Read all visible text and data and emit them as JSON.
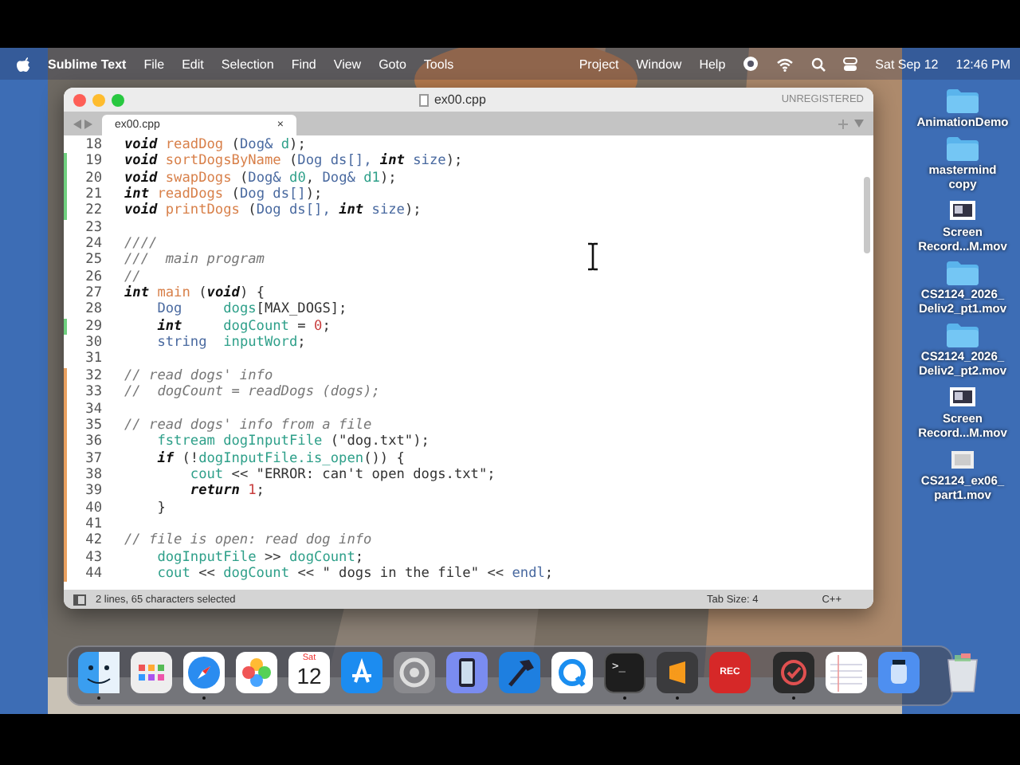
{
  "menu_bar": {
    "app": "Sublime Text",
    "items": [
      "File",
      "Edit",
      "Selection",
      "Find",
      "View",
      "Goto",
      "Tools"
    ],
    "right_items": [
      "Project",
      "Window",
      "Help"
    ],
    "date": "Sat Sep 12",
    "time": "12:46 PM"
  },
  "window": {
    "title": "ex00.cpp",
    "badge": "UNREGISTERED",
    "tabs": [
      {
        "label": "ex00.cpp",
        "selected": true,
        "close": "×"
      }
    ],
    "lines": [
      {
        "number": "18",
        "tokens": [
          {
            "kind": "kw",
            "text": "void "
          },
          {
            "kind": "fn",
            "text": "readDog "
          },
          {
            "kind": "p",
            "text": "("
          },
          {
            "kind": "type",
            "text": "Dog& "
          },
          {
            "kind": "var",
            "text": "d"
          },
          {
            "kind": "p",
            "text": ");"
          }
        ]
      },
      {
        "number": "19",
        "color": "#6fcf7f",
        "tokens": [
          {
            "kind": "kw",
            "text": "void "
          },
          {
            "kind": "fn",
            "text": "sortDogsByName "
          },
          {
            "kind": "p",
            "text": "("
          },
          {
            "kind": "type",
            "text": "Dog ds[], "
          },
          {
            "kind": "kw",
            "text": "int "
          },
          {
            "kind": "type",
            "text": "size"
          },
          {
            "kind": "p",
            "text": ");"
          }
        ]
      },
      {
        "number": "20",
        "color": "#6fcf7f",
        "tokens": [
          {
            "kind": "kw",
            "text": "void "
          },
          {
            "kind": "fn",
            "text": "swapDogs "
          },
          {
            "kind": "p",
            "text": "("
          },
          {
            "kind": "type",
            "text": "Dog& "
          },
          {
            "kind": "var",
            "text": "d0"
          },
          {
            "kind": "p",
            "text": ", "
          },
          {
            "kind": "type",
            "text": "Dog& "
          },
          {
            "kind": "var",
            "text": "d1"
          },
          {
            "kind": "p",
            "text": ");"
          }
        ]
      },
      {
        "number": "21",
        "color": "#6fcf7f",
        "tokens": [
          {
            "kind": "kw",
            "text": "int "
          },
          {
            "kind": "fn",
            "text": "readDogs "
          },
          {
            "kind": "p",
            "text": "("
          },
          {
            "kind": "type",
            "text": "Dog ds[]"
          },
          {
            "kind": "p",
            "text": ");"
          }
        ]
      },
      {
        "number": "22",
        "color": "#6fcf7f",
        "tokens": [
          {
            "kind": "kw",
            "text": "void "
          },
          {
            "kind": "fn",
            "text": "printDogs "
          },
          {
            "kind": "p",
            "text": "("
          },
          {
            "kind": "type",
            "text": "Dog ds[], "
          },
          {
            "kind": "kw",
            "text": "int "
          },
          {
            "kind": "type",
            "text": "size"
          },
          {
            "kind": "p",
            "text": ");"
          }
        ]
      },
      {
        "number": "23"
      },
      {
        "number": "24",
        "tokens": [
          {
            "kind": "cmt",
            "text": "////"
          }
        ]
      },
      {
        "number": "25",
        "tokens": [
          {
            "kind": "cmt",
            "text": "///  main program"
          }
        ]
      },
      {
        "number": "26",
        "tokens": [
          {
            "kind": "cmt",
            "text": "//"
          }
        ]
      },
      {
        "number": "27",
        "tokens": [
          {
            "kind": "kw",
            "text": "int "
          },
          {
            "kind": "fn",
            "text": "main "
          },
          {
            "kind": "p",
            "text": "("
          },
          {
            "kind": "kw",
            "text": "void"
          },
          {
            "kind": "p",
            "text": ") {"
          }
        ]
      },
      {
        "number": "28",
        "tokens": [
          {
            "kind": "type",
            "text": "    Dog     "
          },
          {
            "kind": "var",
            "text": "dogs"
          },
          {
            "kind": "p",
            "text": "[MAX_DOGS];"
          }
        ]
      },
      {
        "number": "29",
        "color": "#6fcf7f",
        "tokens": [
          {
            "kind": "kw",
            "text": "    int     "
          },
          {
            "kind": "var",
            "text": "dogCount"
          },
          {
            "kind": "p",
            "text": " = "
          },
          {
            "kind": "num",
            "text": "0"
          },
          {
            "kind": "p",
            "text": ";"
          }
        ]
      },
      {
        "number": "30",
        "tokens": [
          {
            "kind": "type",
            "text": "    string  "
          },
          {
            "kind": "var",
            "text": "inputWord"
          },
          {
            "kind": "p",
            "text": ";"
          }
        ]
      },
      {
        "number": "31"
      },
      {
        "number": "32",
        "color": "#e8a060",
        "tokens": [
          {
            "kind": "cmt",
            "text": "// read dogs' info"
          }
        ]
      },
      {
        "number": "33",
        "color": "#e8a060",
        "tokens": [
          {
            "kind": "cmt",
            "text": "//  dogCount = readDogs (dogs);"
          }
        ]
      },
      {
        "number": "34",
        "color": "#e8a060"
      },
      {
        "number": "35",
        "color": "#e8a060",
        "tokens": [
          {
            "kind": "cmt",
            "text": "// read dogs' info from a file"
          }
        ]
      },
      {
        "number": "36",
        "color": "#e8a060",
        "tokens": [
          {
            "kind": "var",
            "text": "    fstream dogInputFile"
          },
          {
            "kind": "p",
            "text": " (\"dog.txt\");"
          }
        ]
      },
      {
        "number": "37",
        "color": "#e8a060",
        "tokens": [
          {
            "kind": "kw",
            "text": "    if"
          },
          {
            "kind": "p",
            "text": " (!"
          },
          {
            "kind": "var",
            "text": "dogInputFile.is_open"
          },
          {
            "kind": "p",
            "text": "()) {"
          }
        ]
      },
      {
        "number": "38",
        "color": "#e8a060",
        "tokens": [
          {
            "kind": "var",
            "text": "        cout"
          },
          {
            "kind": "p",
            "text": " << \"ERROR: can't open dogs.txt\";"
          }
        ]
      },
      {
        "number": "39",
        "color": "#e8a060",
        "tokens": [
          {
            "kind": "kw",
            "text": "        return "
          },
          {
            "kind": "num",
            "text": "1"
          },
          {
            "kind": "p",
            "text": ";"
          }
        ]
      },
      {
        "number": "40",
        "color": "#e8a060",
        "tokens": [
          {
            "kind": "p",
            "text": "    }"
          }
        ]
      },
      {
        "number": "41",
        "color": "#e8a060"
      },
      {
        "number": "42",
        "color": "#e8a060",
        "tokens": [
          {
            "kind": "cmt",
            "text": "// file is open: read dog info"
          }
        ]
      },
      {
        "number": "43",
        "color": "#e8a060",
        "tokens": [
          {
            "kind": "var",
            "text": "    dogInputFile"
          },
          {
            "kind": "p",
            "text": " >> "
          },
          {
            "kind": "var",
            "text": "dogCount"
          },
          {
            "kind": "p",
            "text": ";"
          }
        ]
      },
      {
        "number": "44",
        "color": "#e8a060",
        "tokens": [
          {
            "kind": "var",
            "text": "    cout"
          },
          {
            "kind": "p",
            "text": " << "
          },
          {
            "kind": "var",
            "text": "dogCount"
          },
          {
            "kind": "p",
            "text": " << \" dogs in the file\" << "
          },
          {
            "kind": "type",
            "text": "endl"
          },
          {
            "kind": "p",
            "text": ";"
          }
        ]
      }
    ],
    "status_bar": {
      "selection": "2 lines, 65 characters selected",
      "tab_size": "Tab Size: 4",
      "syntax": "C++"
    }
  },
  "desktop_icons": [
    {
      "kind": "folder",
      "label": "AnimationDemo"
    },
    {
      "kind": "folder",
      "label": "mastermind copy"
    },
    {
      "kind": "video",
      "label": "Screen Record...M.mov"
    },
    {
      "kind": "folder",
      "label": "CS2124_2026_ Deliv2_pt1.mov"
    },
    {
      "kind": "folder",
      "label": "CS2124_2026_ Deliv2_pt2.mov"
    },
    {
      "kind": "video",
      "label": "Screen Record...M.mov"
    },
    {
      "kind": "doc",
      "label": "CS2124_ex06_ part1.mov"
    }
  ],
  "dock": [
    {
      "kind": "finder",
      "running": true
    },
    {
      "kind": "launchpad",
      "running": false
    },
    {
      "kind": "safari",
      "running": true
    },
    {
      "kind": "photos",
      "running": false
    },
    {
      "kind": "calendar",
      "running": false,
      "day": "Sat",
      "date": "12"
    },
    {
      "kind": "appstore",
      "running": false
    },
    {
      "kind": "settings",
      "running": false
    },
    {
      "kind": "simulator",
      "running": false
    },
    {
      "kind": "xcode",
      "running": false
    },
    {
      "kind": "quicktime",
      "running": false
    },
    {
      "kind": "terminal",
      "running": true,
      "glyph": ">_"
    },
    {
      "kind": "sublime",
      "running": true
    },
    {
      "kind": "recorder",
      "running": false,
      "label": "REC"
    },
    {
      "kind": "separator"
    },
    {
      "kind": "tasks",
      "running": true
    },
    {
      "kind": "notes",
      "running": false
    },
    {
      "kind": "preview",
      "running": false
    },
    {
      "kind": "separator"
    },
    {
      "kind": "trash",
      "running": false
    }
  ]
}
